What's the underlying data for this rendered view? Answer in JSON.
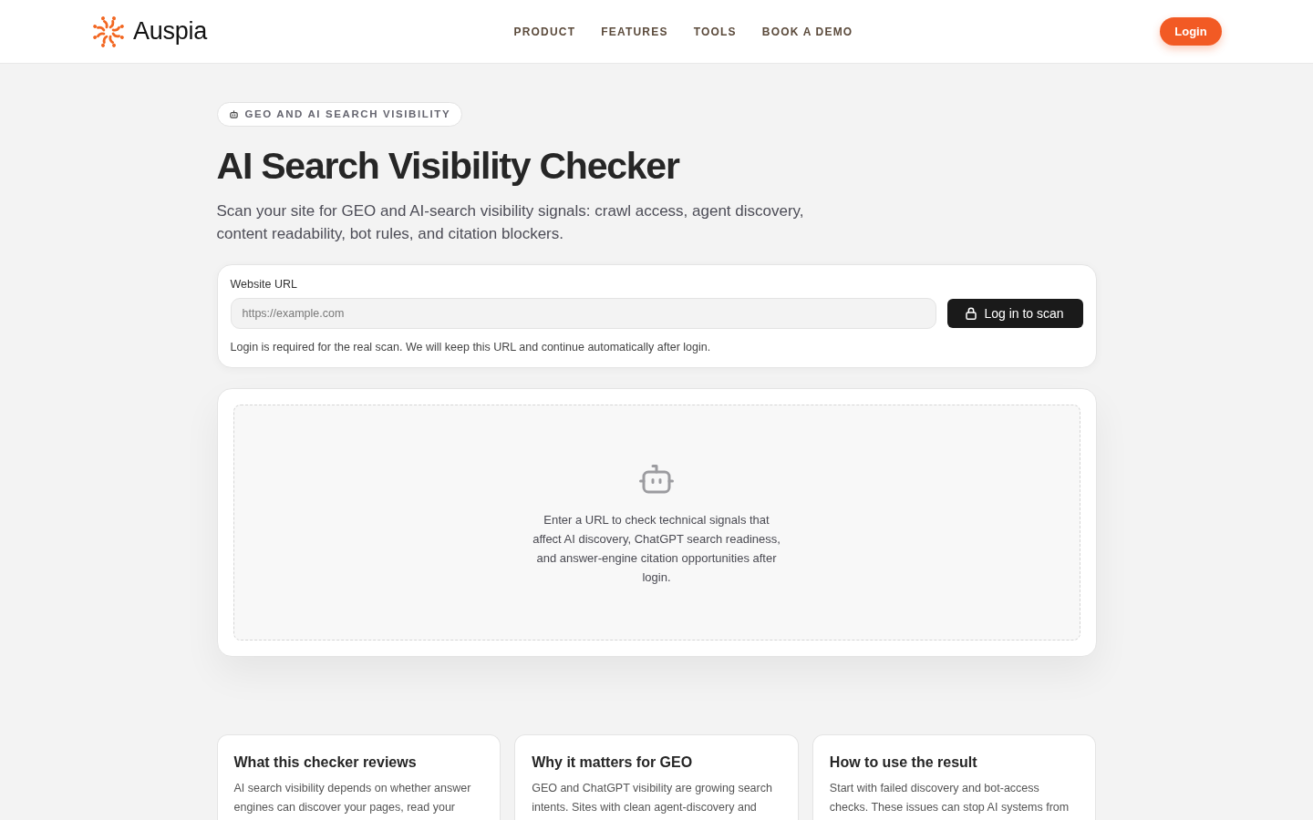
{
  "header": {
    "logo_text": "Auspia",
    "nav": [
      "PRODUCT",
      "FEATURES",
      "TOOLS",
      "BOOK A DEMO"
    ],
    "login_button": "Login"
  },
  "hero": {
    "badge": "GEO AND AI SEARCH VISIBILITY",
    "title": "AI Search Visibility Checker",
    "subtitle": "Scan your site for GEO and AI-search visibility signals: crawl access, agent discovery, content readability, bot rules, and citation blockers."
  },
  "scan_form": {
    "label": "Website URL",
    "placeholder": "https://example.com",
    "button": "Log in to scan",
    "note": "Login is required for the real scan. We will keep this URL and continue automatically after login."
  },
  "empty_state": {
    "message": "Enter a URL to check technical signals that affect AI discovery, ChatGPT search readiness, and answer-engine citation opportunities after login."
  },
  "info_cards": [
    {
      "title": "What this checker reviews",
      "text": "AI search visibility depends on whether answer engines can discover your pages, read your"
    },
    {
      "title": "Why it matters for GEO",
      "text": "GEO and ChatGPT visibility are growing search intents. Sites with clean agent-discovery and"
    },
    {
      "title": "How to use the result",
      "text": "Start with failed discovery and bot-access checks. These issues can stop AI systems from"
    }
  ]
}
